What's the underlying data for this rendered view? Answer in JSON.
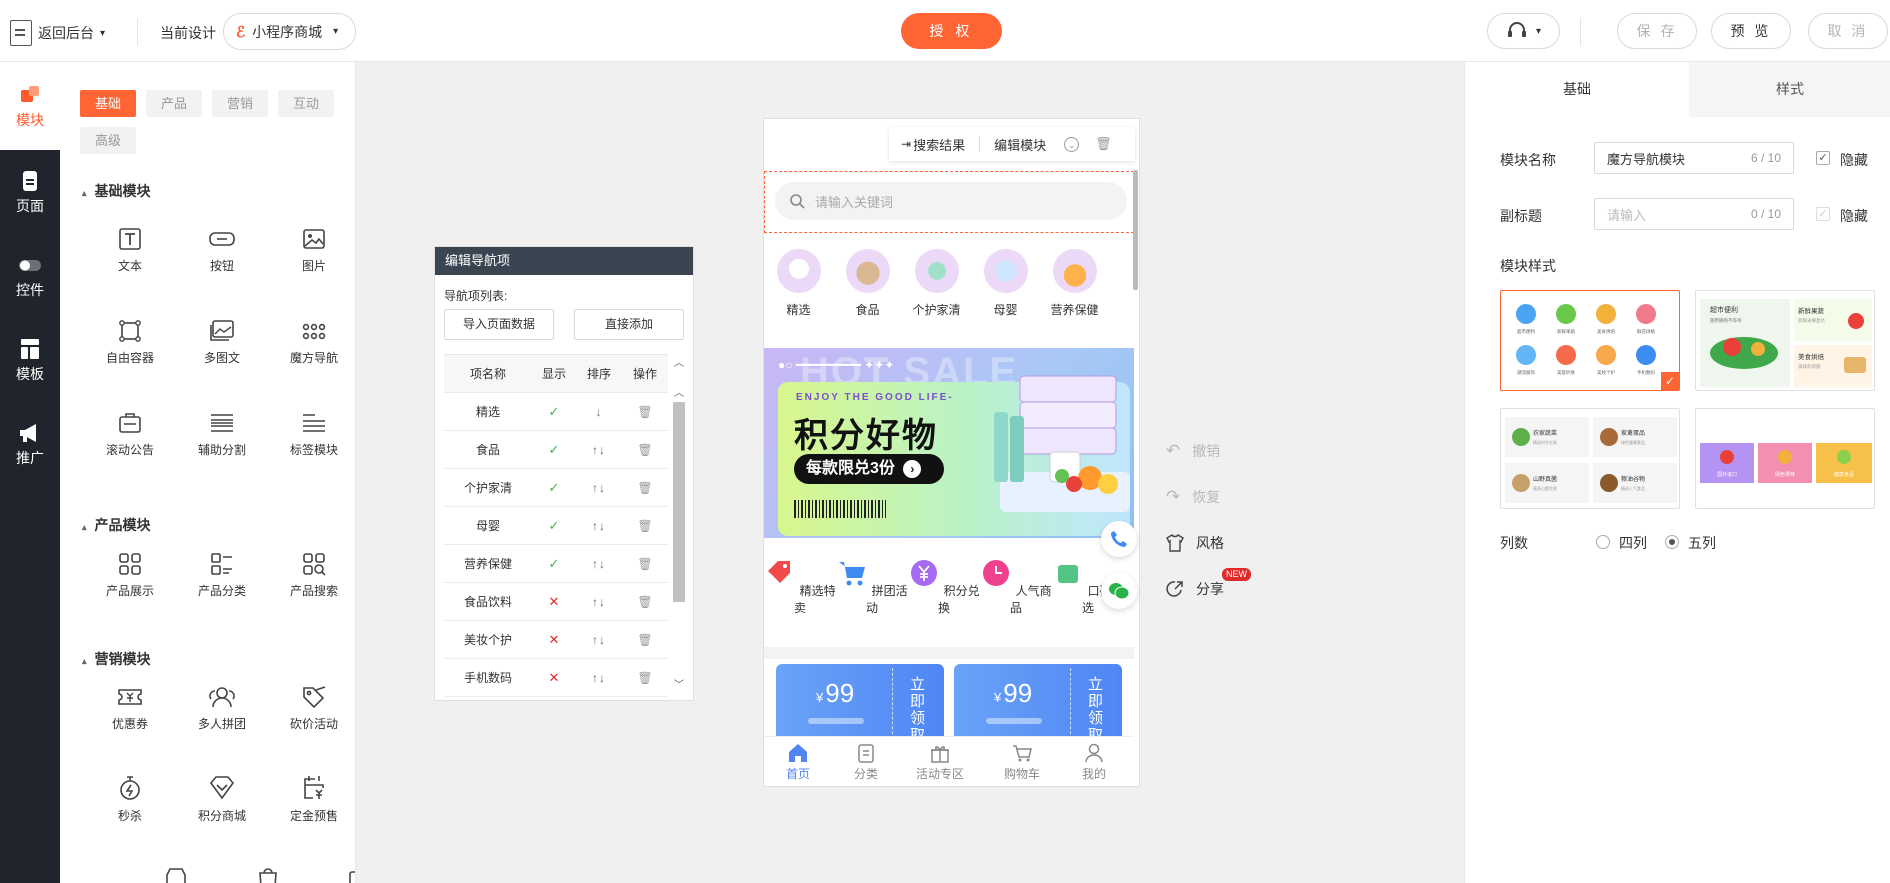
{
  "topbar": {
    "back_label": "返回后台",
    "current_design_label": "当前设计",
    "design_select": "小程序商城",
    "authorize_label": "授 权",
    "save_label": "保 存",
    "preview_label": "预 览",
    "cancel_label": "取 消"
  },
  "iconbar": {
    "items": [
      {
        "label": "模块",
        "icon": "module-icon"
      },
      {
        "label": "页面",
        "icon": "page-icon"
      },
      {
        "label": "控件",
        "icon": "toggle-icon"
      },
      {
        "label": "模板",
        "icon": "template-icon"
      },
      {
        "label": "推广",
        "icon": "megaphone-icon"
      }
    ],
    "active_color": "#ff5a2c"
  },
  "modpanel": {
    "tabs": [
      "基础",
      "产品",
      "营销",
      "互动",
      "高级"
    ],
    "sections": {
      "basic": {
        "title": "基础模块",
        "items": [
          "文本",
          "按钮",
          "图片",
          "自由容器",
          "多图文",
          "魔方导航",
          "滚动公告",
          "辅助分割",
          "标签模块"
        ]
      },
      "product": {
        "title": "产品模块",
        "items": [
          "产品展示",
          "产品分类",
          "产品搜索"
        ]
      },
      "marketing": {
        "title": "营销模块",
        "items": [
          "优惠券",
          "多人拼团",
          "砍价活动",
          "秒杀",
          "积分商城",
          "定金预售"
        ]
      }
    }
  },
  "navedit": {
    "title": "编辑导航项",
    "list_label": "导航项列表:",
    "import_btn": "导入页面数据",
    "add_btn": "直接添加",
    "headers": [
      "项名称",
      "显示",
      "排序",
      "操作"
    ],
    "rows": [
      {
        "name": "精选",
        "show": true
      },
      {
        "name": "食品",
        "show": true
      },
      {
        "name": "个护家清",
        "show": true
      },
      {
        "name": "母婴",
        "show": true
      },
      {
        "name": "营养保健",
        "show": true
      },
      {
        "name": "食品饮料",
        "show": false
      },
      {
        "name": "美妆个护",
        "show": false
      },
      {
        "name": "手机数码",
        "show": false
      }
    ]
  },
  "phone": {
    "toolbar": {
      "search_result": "搜索结果",
      "edit_module": "编辑模块"
    },
    "search_placeholder": "请输入关键词",
    "nav": [
      "精选",
      "食品",
      "个护家清",
      "母婴",
      "营养保健"
    ],
    "banner": {
      "bg_text": "HOT SALE",
      "enjoy": "ENJOY THE GOOD LIFE-",
      "title": "积分好物",
      "pill": "每款限兑3份"
    },
    "nav2": [
      "精选特卖",
      "拼团活动",
      "积分兑换",
      "人气商品",
      "口碑精选"
    ],
    "coupons": [
      {
        "currency": "¥",
        "price": "99",
        "get": "立即领取"
      },
      {
        "currency": "¥",
        "price": "99",
        "get": "立即领取"
      }
    ],
    "tabbar": [
      "首页",
      "分类",
      "活动专区",
      "购物车",
      "我的"
    ]
  },
  "side_actions": {
    "undo": "撤销",
    "redo": "恢复",
    "style": "风格",
    "share": "分享",
    "new_badge": "NEW"
  },
  "rpanel": {
    "tabs": [
      "基础",
      "样式"
    ],
    "module_name_label": "模块名称",
    "module_name_value": "魔方导航模块",
    "module_name_count": "6 / 10",
    "hide_label": "隐藏",
    "subtitle_label": "副标题",
    "subtitle_placeholder": "请输入",
    "subtitle_count": "0 / 10",
    "style_label": "模块样式",
    "style_cards": {
      "s1": [
        "超市便利",
        "新鲜果蔬",
        "美食烘焙",
        "鲜花绿植",
        "潮流服饰",
        "美容护肤",
        "美妆个护",
        "手机数码"
      ],
      "s2": [
        "超市便利",
        "随用随购不等待",
        "新鲜果蔬",
        "新鲜采摘直达",
        "美食烘焙",
        "美味的诱惑"
      ],
      "s3": [
        "农家蔬菜",
        "精选时令生鲜",
        "家禽蛋品",
        "绿色健康食品",
        "山野真菌",
        "营养山野生鲜",
        "粮油谷物",
        "精选人气食品"
      ],
      "s4": [
        "国外进口",
        "绿色果味",
        "健康食品"
      ]
    },
    "columns_label": "列数",
    "col_4": "四列",
    "col_5": "五列",
    "accent": "#ff6434"
  }
}
